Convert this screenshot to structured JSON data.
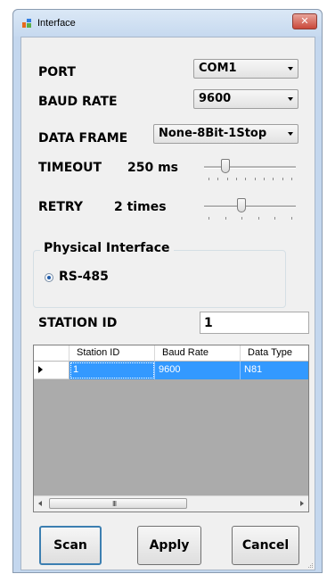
{
  "window": {
    "title": "Interface",
    "close_label": "✕"
  },
  "form": {
    "port_label": "PORT",
    "port_value": "COM1",
    "baud_label": "BAUD RATE",
    "baud_value": "9600",
    "frame_label": "DATA FRAME",
    "frame_value": "None-8Bit-1Stop",
    "timeout_label": "TIMEOUT",
    "timeout_value": "250 ms",
    "timeout_slider_fraction": 0.2,
    "retry_label": "RETRY",
    "retry_value": "2 times",
    "retry_slider_fraction": 0.4,
    "physical_group_label": "Physical Interface",
    "rs485_label": "RS-485",
    "rs485_checked": true,
    "station_label": "STATION ID",
    "station_value": "1"
  },
  "grid": {
    "columns": [
      "Station ID",
      "Baud Rate",
      "Data Type"
    ],
    "rows": [
      [
        "1",
        "9600",
        "N81"
      ]
    ],
    "scroll_grip": "III"
  },
  "buttons": {
    "scan": "Scan",
    "apply": "Apply",
    "cancel": "Cancel"
  },
  "colors": {
    "selection": "#3399ff",
    "grid_background": "#ababab",
    "client": "#f0f0f0"
  }
}
